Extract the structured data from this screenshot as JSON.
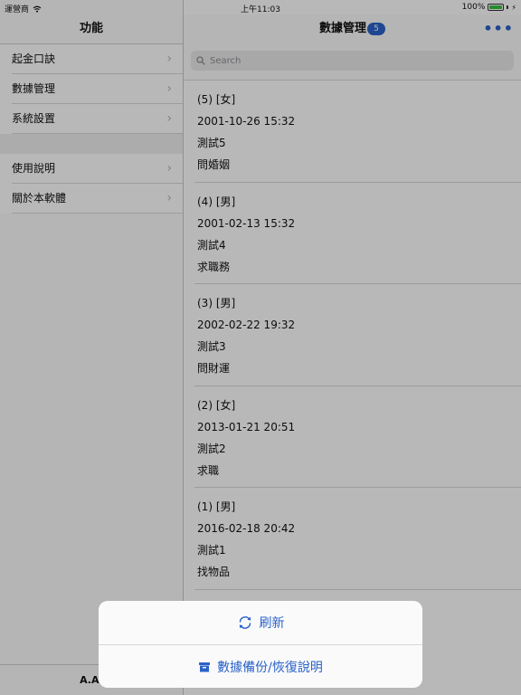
{
  "status_bar": {
    "carrier": "運營商",
    "time": "上午11:03",
    "battery": "100%"
  },
  "master": {
    "title": "功能",
    "items": [
      {
        "label": "起金口訣"
      },
      {
        "label": "數據管理"
      },
      {
        "label": "系統設置"
      },
      {
        "label": "使用說明"
      },
      {
        "label": "關於本軟體"
      }
    ],
    "footer": "A.A."
  },
  "detail": {
    "title": "數據管理",
    "badge": "5",
    "search_placeholder": "Search",
    "records": [
      {
        "header": "(5)  [女]",
        "datetime": "2001-10-26 15:32",
        "name": "測試5",
        "topic": "問婚姻"
      },
      {
        "header": "(4)  [男]",
        "datetime": "2001-02-13 15:32",
        "name": "測試4",
        "topic": "求職務"
      },
      {
        "header": "(3)  [男]",
        "datetime": "2002-02-22 19:32",
        "name": "測試3",
        "topic": "問財運"
      },
      {
        "header": "(2)  [女]",
        "datetime": "2013-01-21 20:51",
        "name": "測試2",
        "topic": "求職"
      },
      {
        "header": "(1)  [男]",
        "datetime": "2016-02-18 20:42",
        "name": "測試1",
        "topic": "找物品"
      }
    ]
  },
  "action_sheet": {
    "refresh_label": "刷新",
    "backup_label": "數據備份/恢復說明"
  },
  "colors": {
    "accent": "#2a62c9",
    "battery": "#38c23e"
  },
  "icons": {
    "wifi": "wifi-icon",
    "chevron": "chevron-right-icon",
    "more": "more-icon",
    "search": "search-icon",
    "refresh": "refresh-icon",
    "archive": "archive-box-icon"
  }
}
